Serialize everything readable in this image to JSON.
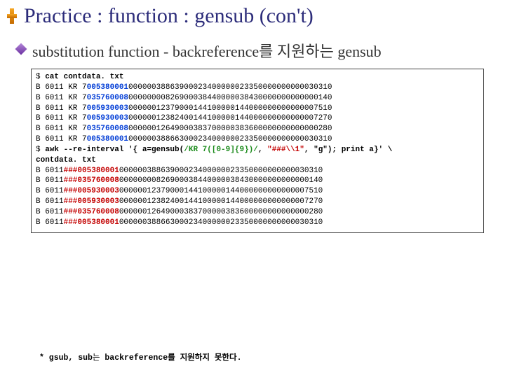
{
  "title": "Practice : function : gensub (con't)",
  "subtitle": "substitution function - backreference를 지원하는 gensub",
  "code": {
    "cmd1_prompt": "$ ",
    "cmd1": "cat contdata. txt",
    "in_prefix": "B 6011 KR 7",
    "in_blue": [
      "005380001",
      "035760008",
      "005930003",
      "005930003",
      "035760008",
      "005380001"
    ],
    "in_rest": [
      "00000038863900023400000023350000000000030310",
      "00000000826900038440000038430000000000000140",
      "00000012379000144100000144000000000000007510",
      "00000012382400144100000144000000000000007270",
      "00000012649000383700000383600000000000000280",
      "00000038866300023400000023350000000000030310"
    ],
    "cmd2_prompt": "$ ",
    "cmd2_a": "awk --re-interval '{ a=gensub(",
    "cmd2_green": "/KR 7([0-9]{9})/",
    "cmd2_b": ", ",
    "cmd2_red": "\"###\\\\1\"",
    "cmd2_c": ", \"g\"); print a}' \\",
    "cmd2_file": "contdata. txt",
    "out_prefix": "B 6011",
    "out_red": [
      "###005380001",
      "###035760008",
      "###005930003",
      "###005930003",
      "###035760008",
      "###005380001"
    ],
    "out_rest": [
      "00000038863900023400000023350000000000030310",
      "00000000826900038440000038430000000000000140",
      "00000012379000144100000144000000000000007510",
      "00000012382400144100000144000000000000007270",
      "00000012649000383700000383600000000000000280",
      "00000038866300023400000023350000000000030310"
    ]
  },
  "footnote_a": "* gsub, sub",
  "footnote_b": "는 ",
  "footnote_c": "backreference",
  "footnote_d": "를 지원하지 못한다."
}
